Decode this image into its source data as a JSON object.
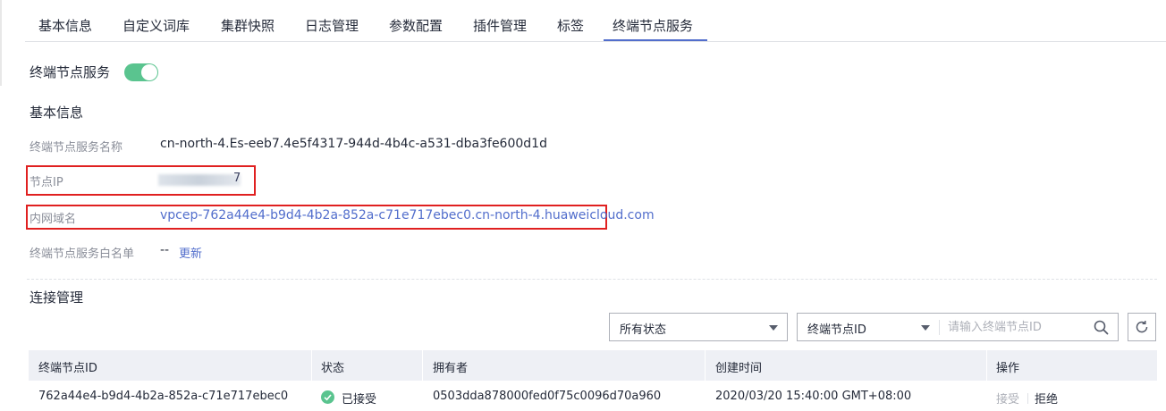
{
  "tabs": [
    {
      "label": "基本信息"
    },
    {
      "label": "自定义词库"
    },
    {
      "label": "集群快照"
    },
    {
      "label": "日志管理"
    },
    {
      "label": "参数配置"
    },
    {
      "label": "插件管理"
    },
    {
      "label": "标签"
    },
    {
      "label": "终端节点服务",
      "active": true
    }
  ],
  "service": {
    "label": "终端节点服务",
    "enabled": true
  },
  "basic_info": {
    "title": "基本信息",
    "name_label": "终端节点服务名称",
    "name_value": "cn-north-4.Es-eeb7.4e5f4317-944d-4b4c-a531-dba3fe600d1d",
    "ip_label": "节点IP",
    "ip_value_visible_tail": "7",
    "domain_label": "内网域名",
    "domain_value": "vpcep-762a44e4-b9d4-4b2a-852a-c71e717ebec0.cn-north-4.huaweicloud.com",
    "whitelist_label": "终端节点服务白名单",
    "whitelist_value": "--",
    "whitelist_update": "更新"
  },
  "connection": {
    "title": "连接管理",
    "status_filter": "所有状态",
    "search_field": "终端节点ID",
    "search_placeholder": "请输入终端节点ID"
  },
  "table": {
    "columns": [
      "终端节点ID",
      "状态",
      "拥有者",
      "创建时间",
      "操作"
    ],
    "rows": [
      {
        "endpoint_id": "762a44e4-b9d4-4b2a-852a-c71e717ebec0",
        "status": "已接受",
        "owner": "0503dda878000fed0f75c0096d70a960",
        "created": "2020/03/20 15:40:00 GMT+08:00",
        "action_accept": "接受",
        "action_reject": "拒绝"
      }
    ]
  },
  "colors": {
    "accent": "#526ecc",
    "toggle_on": "#5ac48f",
    "highlight_box": "#e02020",
    "header_bg": "#eef0f5"
  }
}
